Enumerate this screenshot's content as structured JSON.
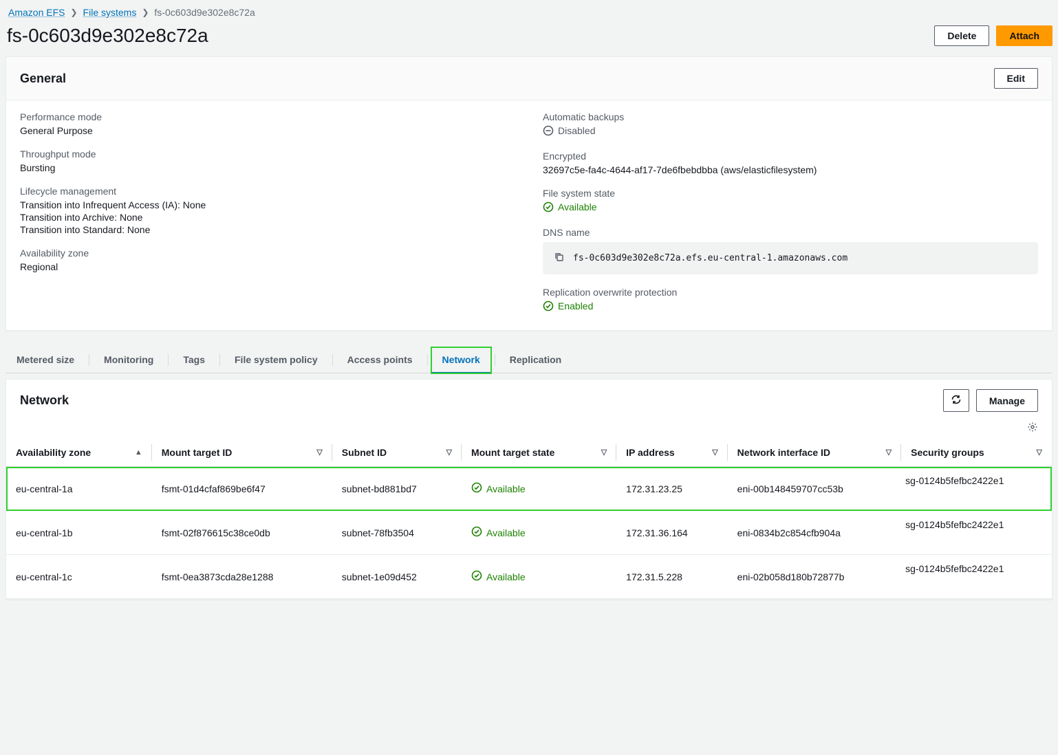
{
  "breadcrumb": {
    "service": "Amazon EFS",
    "section": "File systems",
    "current": "fs-0c603d9e302e8c72a"
  },
  "page_title": "fs-0c603d9e302e8c72a",
  "actions": {
    "delete": "Delete",
    "attach": "Attach"
  },
  "general": {
    "heading": "General",
    "edit": "Edit",
    "left": {
      "performance_mode": {
        "label": "Performance mode",
        "value": "General Purpose"
      },
      "throughput_mode": {
        "label": "Throughput mode",
        "value": "Bursting"
      },
      "lifecycle": {
        "label": "Lifecycle management",
        "ia": "Transition into Infrequent Access (IA): None",
        "archive": "Transition into Archive: None",
        "standard": "Transition into Standard: None"
      },
      "az": {
        "label": "Availability zone",
        "value": "Regional"
      }
    },
    "right": {
      "backups": {
        "label": "Automatic backups",
        "value": "Disabled"
      },
      "encrypted": {
        "label": "Encrypted",
        "value": "32697c5e-fa4c-4644-af17-7de6fbebdbba (aws/elasticfilesystem)"
      },
      "state": {
        "label": "File system state",
        "value": "Available"
      },
      "dns": {
        "label": "DNS name",
        "value": "fs-0c603d9e302e8c72a.efs.eu-central-1.amazonaws.com"
      },
      "replication_protect": {
        "label": "Replication overwrite protection",
        "value": "Enabled"
      }
    }
  },
  "tabs": {
    "items": [
      {
        "label": "Metered size"
      },
      {
        "label": "Monitoring"
      },
      {
        "label": "Tags"
      },
      {
        "label": "File system policy"
      },
      {
        "label": "Access points"
      },
      {
        "label": "Network",
        "active": true
      },
      {
        "label": "Replication"
      }
    ]
  },
  "network": {
    "heading": "Network",
    "manage": "Manage",
    "columns": {
      "az": "Availability zone",
      "mt_id": "Mount target ID",
      "subnet": "Subnet ID",
      "mt_state": "Mount target state",
      "ip": "IP address",
      "eni": "Network interface ID",
      "sg": "Security groups"
    },
    "rows": [
      {
        "az": "eu-central-1a",
        "mt_id": "fsmt-01d4cfaf869be6f47",
        "subnet": "subnet-bd881bd7",
        "state": "Available",
        "ip": "172.31.23.25",
        "eni": "eni-00b148459707cc53b",
        "sg": "sg-0124b5fefbc2422e1",
        "highlight": true
      },
      {
        "az": "eu-central-1b",
        "mt_id": "fsmt-02f876615c38ce0db",
        "subnet": "subnet-78fb3504",
        "state": "Available",
        "ip": "172.31.36.164",
        "eni": "eni-0834b2c854cfb904a",
        "sg": "sg-0124b5fefbc2422e1"
      },
      {
        "az": "eu-central-1c",
        "mt_id": "fsmt-0ea3873cda28e1288",
        "subnet": "subnet-1e09d452",
        "state": "Available",
        "ip": "172.31.5.228",
        "eni": "eni-02b058d180b72877b",
        "sg": "sg-0124b5fefbc2422e1"
      }
    ]
  }
}
